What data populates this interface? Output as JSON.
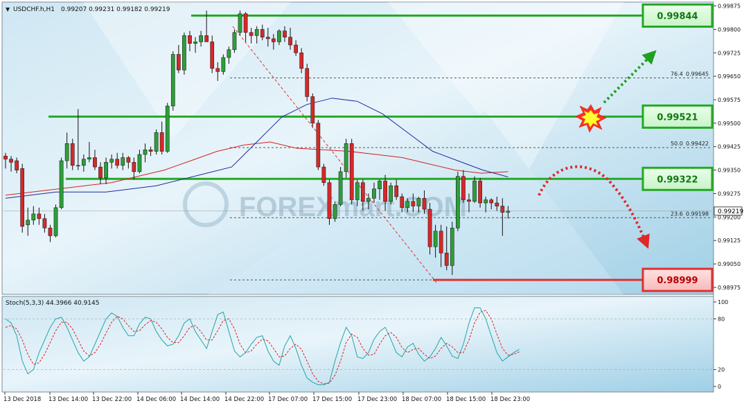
{
  "main_chart": {
    "symbol_label": "USDCHF.h,H1",
    "ohlc_label": "0.99207 0.99231 0.99182 0.99219",
    "watermark": "FOREXmart.COM",
    "current_price": "0.99219",
    "y_ticks": [
      {
        "v": 0.99875,
        "t": "0.99875"
      },
      {
        "v": 0.998,
        "t": "0.99800"
      },
      {
        "v": 0.99725,
        "t": "0.99725"
      },
      {
        "v": 0.9965,
        "t": "0.99650"
      },
      {
        "v": 0.99575,
        "t": "0.99575"
      },
      {
        "v": 0.995,
        "t": "0.99500"
      },
      {
        "v": 0.99425,
        "t": "0.99425"
      },
      {
        "v": 0.9935,
        "t": "0.99350"
      },
      {
        "v": 0.99275,
        "t": "0.99275"
      },
      {
        "v": 0.992,
        "t": "0.99200"
      },
      {
        "v": 0.99125,
        "t": "0.99125"
      },
      {
        "v": 0.9905,
        "t": "0.99050"
      },
      {
        "v": 0.98975,
        "t": "0.98975"
      }
    ]
  },
  "levels": [
    {
      "price": 0.99844,
      "label": "0.99844",
      "kind": "resistance"
    },
    {
      "price": 0.99521,
      "label": "0.99521",
      "kind": "resistance"
    },
    {
      "price": 0.99322,
      "label": "0.99322",
      "kind": "resistance"
    },
    {
      "price": 0.98999,
      "label": "0.98999",
      "kind": "support"
    }
  ],
  "fibonacci": [
    {
      "ratio": "76.4",
      "price": 0.99645,
      "label": "0.99645"
    },
    {
      "ratio": "50.0",
      "price": 0.99422,
      "label": "0.99422"
    },
    {
      "ratio": "23.6",
      "price": 0.99198,
      "label": "0.99198"
    }
  ],
  "stoch": {
    "label": "Stoch(5,3,3) 44.3966 40.9145",
    "y_ticks": [
      {
        "v": 100,
        "t": "100"
      },
      {
        "v": 80,
        "t": "80"
      },
      {
        "v": 20,
        "t": "20"
      },
      {
        "v": 0,
        "t": "0"
      }
    ]
  },
  "x_axis": [
    "13 Dec 2018",
    "13 Dec 14:00",
    "13 Dec 22:00",
    "14 Dec 06:00",
    "14 Dec 14:00",
    "14 Dec 22:00",
    "17 Dec 07:00",
    "17 Dec 15:00",
    "17 Dec 23:00",
    "18 Dec 07:00",
    "18 Dec 15:00",
    "18 Dec 23:00"
  ],
  "colors": {
    "bull": "#2e9e3a",
    "bear": "#d62828",
    "resistance": "#22aa22",
    "support": "#e03030",
    "ma_fast": "#1a2aa0",
    "ma_slow": "#d42020",
    "stoch_main": "#20a5a8",
    "stoch_signal": "#dd2020"
  },
  "chart_data": [
    {
      "type": "candlestick",
      "title": "USDCHF.h,H1",
      "ylim": [
        0.98955,
        0.99885
      ],
      "candles": [
        [
          0.99395,
          0.99405,
          0.99355,
          0.99385
        ],
        [
          0.99385,
          0.99395,
          0.99345,
          0.99375
        ],
        [
          0.9938,
          0.9939,
          0.9934,
          0.9935
        ],
        [
          0.99355,
          0.9937,
          0.9915,
          0.9917
        ],
        [
          0.99175,
          0.9923,
          0.9914,
          0.9919
        ],
        [
          0.9919,
          0.99235,
          0.99175,
          0.9921
        ],
        [
          0.9921,
          0.9923,
          0.99175,
          0.99195
        ],
        [
          0.99195,
          0.9921,
          0.9915,
          0.99165
        ],
        [
          0.99165,
          0.99175,
          0.9912,
          0.9914
        ],
        [
          0.9914,
          0.9924,
          0.99135,
          0.9923
        ],
        [
          0.9923,
          0.9939,
          0.99225,
          0.9938
        ],
        [
          0.9938,
          0.9947,
          0.99355,
          0.99435
        ],
        [
          0.99435,
          0.9945,
          0.9935,
          0.99365
        ],
        [
          0.99365,
          0.99545,
          0.9935,
          0.99365
        ],
        [
          0.99365,
          0.994,
          0.99345,
          0.99385
        ],
        [
          0.99385,
          0.9944,
          0.99375,
          0.9939
        ],
        [
          0.9939,
          0.99415,
          0.9935,
          0.9936
        ],
        [
          0.9936,
          0.99375,
          0.99305,
          0.99325
        ],
        [
          0.99325,
          0.9939,
          0.99305,
          0.99375
        ],
        [
          0.99375,
          0.994,
          0.99355,
          0.99385
        ],
        [
          0.99385,
          0.99405,
          0.99355,
          0.99365
        ],
        [
          0.99365,
          0.99405,
          0.9935,
          0.9939
        ],
        [
          0.9939,
          0.99395,
          0.99355,
          0.99375
        ],
        [
          0.99375,
          0.9939,
          0.9932,
          0.99345
        ],
        [
          0.99345,
          0.99415,
          0.9934,
          0.994
        ],
        [
          0.994,
          0.99435,
          0.99375,
          0.99415
        ],
        [
          0.99415,
          0.99425,
          0.99395,
          0.9941
        ],
        [
          0.9941,
          0.9948,
          0.994,
          0.9947
        ],
        [
          0.9947,
          0.99505,
          0.994,
          0.9941
        ],
        [
          0.9941,
          0.99565,
          0.99405,
          0.99555
        ],
        [
          0.99555,
          0.9973,
          0.9954,
          0.9972
        ],
        [
          0.9972,
          0.9975,
          0.9966,
          0.9967
        ],
        [
          0.9967,
          0.9979,
          0.99655,
          0.9978
        ],
        [
          0.9978,
          0.99795,
          0.9973,
          0.99755
        ],
        [
          0.99755,
          0.99775,
          0.99725,
          0.9976
        ],
        [
          0.9976,
          0.99795,
          0.99745,
          0.9978
        ],
        [
          0.9978,
          0.9986,
          0.99765,
          0.9976
        ],
        [
          0.9976,
          0.9978,
          0.9966,
          0.99675
        ],
        [
          0.99675,
          0.99695,
          0.99635,
          0.99665
        ],
        [
          0.99665,
          0.9972,
          0.99655,
          0.9971
        ],
        [
          0.9971,
          0.99745,
          0.9969,
          0.99735
        ],
        [
          0.99735,
          0.998,
          0.99725,
          0.9979
        ],
        [
          0.9979,
          0.9986,
          0.9978,
          0.9985
        ],
        [
          0.9985,
          0.99855,
          0.9976,
          0.9979
        ],
        [
          0.9979,
          0.99805,
          0.99755,
          0.9978
        ],
        [
          0.9978,
          0.9981,
          0.99755,
          0.998
        ],
        [
          0.998,
          0.99815,
          0.99765,
          0.99775
        ],
        [
          0.99775,
          0.99805,
          0.99745,
          0.9977
        ],
        [
          0.9977,
          0.99785,
          0.99735,
          0.9976
        ],
        [
          0.9976,
          0.998,
          0.9975,
          0.99795
        ],
        [
          0.99795,
          0.9981,
          0.9976,
          0.99775
        ],
        [
          0.99775,
          0.99805,
          0.99735,
          0.9975
        ],
        [
          0.9975,
          0.99765,
          0.99715,
          0.99725
        ],
        [
          0.99725,
          0.9974,
          0.9966,
          0.99675
        ],
        [
          0.99675,
          0.9969,
          0.9957,
          0.99585
        ],
        [
          0.99585,
          0.99595,
          0.99485,
          0.995
        ],
        [
          0.995,
          0.9951,
          0.9935,
          0.9936
        ],
        [
          0.9936,
          0.9937,
          0.993,
          0.9931
        ],
        [
          0.9931,
          0.9932,
          0.99175,
          0.99195
        ],
        [
          0.99195,
          0.9925,
          0.99185,
          0.9924
        ],
        [
          0.9924,
          0.9936,
          0.99235,
          0.99345
        ],
        [
          0.99345,
          0.9945,
          0.99325,
          0.99435
        ],
        [
          0.99435,
          0.9945,
          0.9924,
          0.99255
        ],
        [
          0.99255,
          0.9932,
          0.99235,
          0.9931
        ],
        [
          0.9931,
          0.9932,
          0.9922,
          0.9925
        ],
        [
          0.9925,
          0.99275,
          0.99225,
          0.9926
        ],
        [
          0.9926,
          0.9931,
          0.99245,
          0.9929
        ],
        [
          0.9929,
          0.9932,
          0.99255,
          0.99315
        ],
        [
          0.99315,
          0.99335,
          0.9922,
          0.9925
        ],
        [
          0.9925,
          0.9931,
          0.9924,
          0.993
        ],
        [
          0.993,
          0.9932,
          0.99255,
          0.99265
        ],
        [
          0.99265,
          0.99275,
          0.99215,
          0.9923
        ],
        [
          0.9923,
          0.9926,
          0.99215,
          0.9925
        ],
        [
          0.9925,
          0.99275,
          0.99215,
          0.99235
        ],
        [
          0.99235,
          0.99265,
          0.99215,
          0.9926
        ],
        [
          0.9926,
          0.99285,
          0.9921,
          0.99225
        ],
        [
          0.99225,
          0.99245,
          0.9908,
          0.99105
        ],
        [
          0.99105,
          0.99175,
          0.9907,
          0.99155
        ],
        [
          0.99155,
          0.99175,
          0.9904,
          0.99085
        ],
        [
          0.99085,
          0.9917,
          0.9903,
          0.99045
        ],
        [
          0.99045,
          0.99185,
          0.99015,
          0.99165
        ],
        [
          0.99165,
          0.99345,
          0.99155,
          0.9933
        ],
        [
          0.9933,
          0.9935,
          0.99245,
          0.99255
        ],
        [
          0.99255,
          0.99275,
          0.99215,
          0.9925
        ],
        [
          0.9925,
          0.9933,
          0.99245,
          0.99315
        ],
        [
          0.99315,
          0.99325,
          0.9923,
          0.99245
        ],
        [
          0.99245,
          0.99265,
          0.99215,
          0.99255
        ],
        [
          0.99255,
          0.9926,
          0.99225,
          0.99245
        ],
        [
          0.99245,
          0.99265,
          0.9922,
          0.99235
        ],
        [
          0.99235,
          0.9926,
          0.9914,
          0.99215
        ],
        [
          0.99215,
          0.99235,
          0.99195,
          0.99219
        ]
      ],
      "ma_fast": [
        0.9926,
        0.9927,
        0.9928,
        0.9928,
        0.9928,
        0.9929,
        0.993,
        0.9932,
        0.9934,
        0.9936,
        0.9944,
        0.9952,
        0.9956,
        0.9958,
        0.9957,
        0.9953,
        0.9947,
        0.9941,
        0.9938,
        0.9935,
        0.99328
      ],
      "ma_slow": [
        0.9927,
        0.9928,
        0.9929,
        0.993,
        0.9931,
        0.9933,
        0.9935,
        0.9938,
        0.9941,
        0.9943,
        0.9944,
        0.9942,
        0.99415,
        0.9941,
        0.994,
        0.9939,
        0.9937,
        0.9935,
        0.9934,
        0.99345
      ]
    },
    {
      "type": "line",
      "title": "Stoch(5,3,3) 44.3966 40.9145",
      "ylim": [
        0,
        100
      ],
      "series": [
        {
          "values": [
            80,
            75,
            60,
            30,
            15,
            20,
            40,
            55,
            70,
            80,
            82,
            70,
            55,
            40,
            30,
            35,
            50,
            65,
            80,
            87,
            83,
            70,
            60,
            60,
            74,
            82,
            80,
            65,
            55,
            48,
            50,
            60,
            75,
            80,
            65,
            55,
            45,
            65,
            85,
            88,
            65,
            42,
            35,
            40,
            50,
            58,
            60,
            42,
            30,
            25,
            48,
            60,
            45,
            25,
            10,
            5,
            2,
            2,
            5,
            30,
            52,
            70,
            60,
            35,
            33,
            40,
            56,
            65,
            70,
            56,
            40,
            35,
            47,
            51,
            38,
            30,
            35,
            45,
            58,
            48,
            36,
            33,
            50,
            75,
            93,
            93,
            80,
            60,
            40,
            30,
            35,
            40,
            44
          ]
        },
        {
          "values": [
            70,
            72,
            68,
            55,
            38,
            26,
            28,
            38,
            52,
            66,
            76,
            76,
            68,
            55,
            42,
            36,
            40,
            50,
            63,
            76,
            83,
            80,
            72,
            65,
            66,
            73,
            78,
            76,
            68,
            58,
            52,
            52,
            60,
            70,
            72,
            65,
            55,
            55,
            66,
            78,
            80,
            68,
            50,
            40,
            42,
            50,
            56,
            54,
            45,
            35,
            36,
            45,
            50,
            44,
            30,
            15,
            6,
            3,
            4,
            13,
            30,
            52,
            62,
            58,
            45,
            37,
            38,
            50,
            60,
            64,
            58,
            46,
            40,
            44,
            45,
            38,
            33,
            36,
            45,
            51,
            47,
            40,
            40,
            55,
            75,
            88,
            90,
            80,
            62,
            45,
            37,
            38,
            41
          ]
        }
      ]
    }
  ]
}
